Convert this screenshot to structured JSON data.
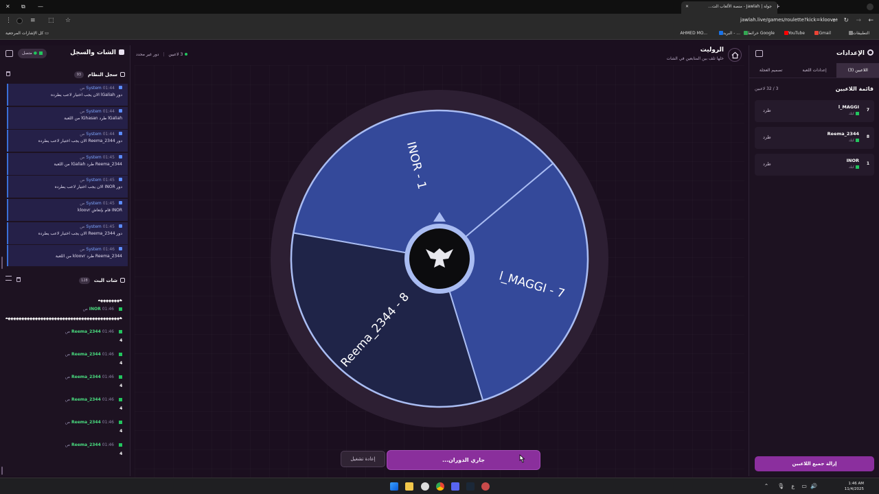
{
  "browser": {
    "tab_title": "جولة | Jawlah - منصة الألعاب الت...",
    "url": "jawlah.live/games/roulette?kick=kloovr",
    "bookmarks_all": "كل الإشارات المرجعية",
    "bookmarks": [
      "التطبيقات",
      "Gmail",
      "YouTube",
      "خرائط Google",
      "البريد - ...",
      "AHMED MO..."
    ]
  },
  "header": {
    "title": "الروليت",
    "subtitle": "خلها تلف بين المتابعين في الشات",
    "players_count": "3 لاعبين",
    "turn_status": "دور غير محدد"
  },
  "chat_panel": {
    "title": "الشات والسجل",
    "online": "متصل",
    "system_log_title": "سجل النظام",
    "system_log_count": "93",
    "live_chat_title": "شات البث",
    "live_chat_count": "128"
  },
  "system_log": [
    {
      "sender": "System",
      "time": "01:44 ص",
      "msg": "دور lGaliah الان يجب اختيار لاعب يطرده"
    },
    {
      "sender": "System",
      "time": "01:44 ص",
      "msg": "lGaliah طرد lGhasan من اللعبة"
    },
    {
      "sender": "System",
      "time": "01:44 ص",
      "msg": "دور Reema_2344 الان يجب اختيار لاعب يطرده"
    },
    {
      "sender": "System",
      "time": "01:45 ص",
      "msg": "Reema_2344 طرد lGaliah من اللعبة"
    },
    {
      "sender": "System",
      "time": "01:45 ص",
      "msg": "دور INOR الان يجب اختيار لاعب يطرده"
    },
    {
      "sender": "System",
      "time": "01:45 ص",
      "msg": "INOR قام بإنعاش kloovr"
    },
    {
      "sender": "System",
      "time": "01:45 ص",
      "msg": "دور Reema_2344 الان يجب اختيار لاعب يطرده"
    },
    {
      "sender": "System",
      "time": "01:46 ص",
      "msg": "Reema_2344 طرد kloovr من اللعبة"
    }
  ],
  "live_chat": [
    {
      "user": "",
      "time": "",
      "text": "ههههههههه"
    },
    {
      "user": "INOR",
      "time": "01:46 ص",
      "text": "ههههههههههههههههههههههههههههههههههههههههههه"
    },
    {
      "user": "Reema_2344",
      "time": "01:46 ص",
      "text": "4"
    },
    {
      "user": "Reema_2344",
      "time": "01:46 ص",
      "text": "4"
    },
    {
      "user": "Reema_2344",
      "time": "01:46 ص",
      "text": "4"
    },
    {
      "user": "Reema_2344",
      "time": "01:46 ص",
      "text": "4"
    },
    {
      "user": "Reema_2344",
      "time": "01:46 ص",
      "text": "4"
    },
    {
      "user": "Reema_2344",
      "time": "01:46 ص",
      "text": "4"
    }
  ],
  "settings_panel": {
    "title": "الإعدادات",
    "tabs": [
      "اللاعبين (3)",
      "إعدادات اللعبة",
      "تصميم العجلة"
    ],
    "players_title": "قائمة اللاعبين",
    "players_count": "3 / 32 لاعبين",
    "kick_label": "طرد",
    "player_sub": "كيك",
    "remove_all": "إزالة جميع اللاعبين"
  },
  "players": [
    {
      "num": "7",
      "name": "l_MAGGI"
    },
    {
      "num": "8",
      "name": "Reema_2344"
    },
    {
      "num": "1",
      "name": "INOR"
    }
  ],
  "wheel": {
    "segments": [
      {
        "label": "INOR - 1",
        "color": "#34499a"
      },
      {
        "label": "l_MAGGI - 7",
        "color": "#34499a"
      },
      {
        "label": "Reema_2344 - 8",
        "color": "#1f2448"
      }
    ]
  },
  "controls": {
    "spin": "جاري الدوران...",
    "reset": "إعادة تشغيل"
  },
  "taskbar": {
    "clock_time": "1:46 AM",
    "clock_date": "11/4/2025",
    "lang": "ع"
  }
}
